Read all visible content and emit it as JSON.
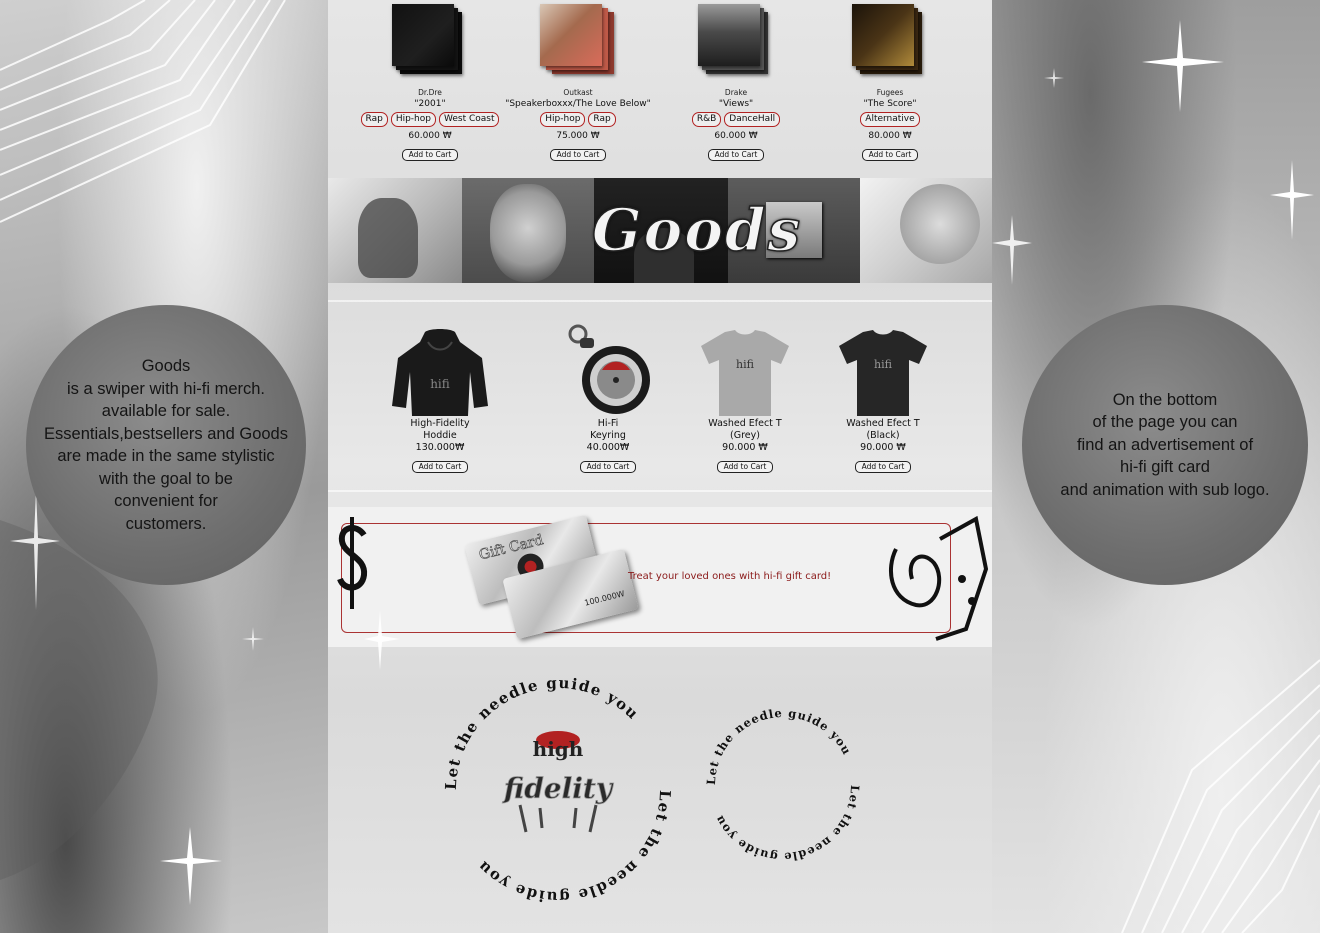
{
  "notes": {
    "left": [
      "Goods",
      "is a swiper with hi-fi merch.",
      "available for sale.",
      "Essentials,bestsellers and Goods",
      "are made in the same stylistic",
      "with the goal to be",
      "convenient for",
      "customers."
    ],
    "right": [
      "On the bottom",
      "of the page you can",
      "find an advertisement of",
      "hi-fi gift card",
      "and animation with sub logo."
    ]
  },
  "albums": [
    {
      "artist": "Dr.Dre",
      "title": "\"2001\"",
      "tags": [
        "Rap",
        "Hip-hop",
        "West Coast"
      ],
      "price": "60.000 ₩",
      "cart": "Add to Cart"
    },
    {
      "artist": "Outkast",
      "title": "\"Speakerboxxx/The Love Below\"",
      "tags": [
        "Hip-hop",
        "Rap"
      ],
      "price": "75.000 ₩",
      "cart": "Add to Cart"
    },
    {
      "artist": "Drake",
      "title": "\"Views\"",
      "tags": [
        "R&B",
        "DanceHall"
      ],
      "price": "60.000 ₩",
      "cart": "Add to Cart"
    },
    {
      "artist": "Fugees",
      "title": "\"The Score\"",
      "tags": [
        "Alternative"
      ],
      "price": "80.000 ₩",
      "cart": "Add to Cart"
    }
  ],
  "banner": {
    "title": "Goods"
  },
  "goods": [
    {
      "name1": "High-Fidelity",
      "name2": "Hoddie",
      "price": "130.000₩",
      "cart": "Add to Cart"
    },
    {
      "name1": "Hi-Fi",
      "name2": "Keyring",
      "price": "40.000₩",
      "cart": "Add to Cart"
    },
    {
      "name1": "Washed Efect T",
      "name2": "(Grey)",
      "price": "90.000 ₩",
      "cart": "Add to Cart"
    },
    {
      "name1": "Washed Efect T",
      "name2": "(Black)",
      "price": "90.000 ₩",
      "cart": "Add to Cart"
    }
  ],
  "gift": {
    "card_title": "Gift Card",
    "card_value": "100.000W",
    "tagline": "Treat your loved ones with hi-fi gift card!"
  },
  "logo": {
    "ring_text": "Let the needle guide you",
    "main_top": "high",
    "main_bottom": "fidelity"
  },
  "colors": {
    "accent": "#b22222",
    "text": "#111111"
  }
}
